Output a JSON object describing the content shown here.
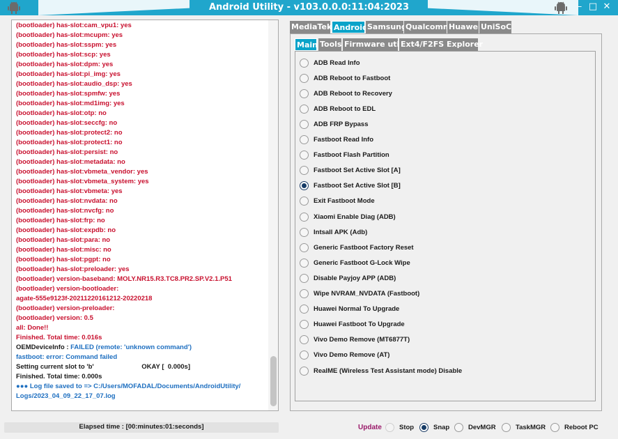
{
  "window": {
    "title": "Android Utility - v103.0.0.0:11:04:2023",
    "minimize": "–",
    "maximize": "□",
    "close": "✕"
  },
  "colors": {
    "titlebar": "#20a6cc",
    "active_tab": "#0aa3c9",
    "log_red": "#c8102e",
    "log_blue": "#1e6fc0"
  },
  "log": [
    {
      "text": "(bootloader) has-slot:cam_vpu1: yes",
      "color": "red"
    },
    {
      "text": "(bootloader) has-slot:mcupm: yes",
      "color": "red"
    },
    {
      "text": "(bootloader) has-slot:sspm: yes",
      "color": "red"
    },
    {
      "text": "(bootloader) has-slot:scp: yes",
      "color": "red"
    },
    {
      "text": "(bootloader) has-slot:dpm: yes",
      "color": "red"
    },
    {
      "text": "(bootloader) has-slot:pi_img: yes",
      "color": "red"
    },
    {
      "text": "(bootloader) has-slot:audio_dsp: yes",
      "color": "red"
    },
    {
      "text": "(bootloader) has-slot:spmfw: yes",
      "color": "red"
    },
    {
      "text": "(bootloader) has-slot:md1img: yes",
      "color": "red"
    },
    {
      "text": "(bootloader) has-slot:otp: no",
      "color": "red"
    },
    {
      "text": "(bootloader) has-slot:seccfg: no",
      "color": "red"
    },
    {
      "text": "(bootloader) has-slot:protect2: no",
      "color": "red"
    },
    {
      "text": "(bootloader) has-slot:protect1: no",
      "color": "red"
    },
    {
      "text": "(bootloader) has-slot:persist: no",
      "color": "red"
    },
    {
      "text": "(bootloader) has-slot:metadata: no",
      "color": "red"
    },
    {
      "text": "(bootloader) has-slot:vbmeta_vendor: yes",
      "color": "red"
    },
    {
      "text": "(bootloader) has-slot:vbmeta_system: yes",
      "color": "red"
    },
    {
      "text": "(bootloader) has-slot:vbmeta: yes",
      "color": "red"
    },
    {
      "text": "(bootloader) has-slot:nvdata: no",
      "color": "red"
    },
    {
      "text": "(bootloader) has-slot:nvcfg: no",
      "color": "red"
    },
    {
      "text": "(bootloader) has-slot:frp: no",
      "color": "red"
    },
    {
      "text": "(bootloader) has-slot:expdb: no",
      "color": "red"
    },
    {
      "text": "(bootloader) has-slot:para: no",
      "color": "red"
    },
    {
      "text": "(bootloader) has-slot:misc: no",
      "color": "red"
    },
    {
      "text": "(bootloader) has-slot:pgpt: no",
      "color": "red"
    },
    {
      "text": "(bootloader) has-slot:preloader: yes",
      "color": "red"
    },
    {
      "text": "(bootloader) version-baseband: MOLY.NR15.R3.TC8.PR2.SP.V2.1.P51",
      "color": "red"
    },
    {
      "text": "(bootloader) version-bootloader:",
      "color": "red"
    },
    {
      "text": "agate-555e9123f-20211220161212-20220218",
      "color": "red"
    },
    {
      "text": "(bootloader) version-preloader:",
      "color": "red"
    },
    {
      "text": "(bootloader) version: 0.5",
      "color": "red"
    },
    {
      "text": "all: Done!!",
      "color": "red"
    },
    {
      "text": "Finished. Total time: 0.016s",
      "color": "red"
    },
    {
      "text": "OEMDeviceInfo  :   FAILED (remote: 'unknown command')",
      "color": "mixed",
      "prefix": "OEMDeviceInfo  :   ",
      "suffix": "FAILED (remote: 'unknown command')"
    },
    {
      "text": "fastboot: error: Command failed",
      "color": "blue"
    },
    {
      "text": "Setting current slot to 'b'                          OKAY [  0.000s]",
      "color": "black"
    },
    {
      "text": "Finished. Total time: 0.000s",
      "color": "black"
    },
    {
      "text": "●●● Log file saved to => C:/Users/MOFADAL/Documents/AndroidUtility/",
      "color": "blue"
    },
    {
      "text": "Logs/2023_04_09_22_17_07.log",
      "color": "blue"
    }
  ],
  "top_tabs": [
    {
      "label": "MediaTek",
      "active": false
    },
    {
      "label": "Android",
      "active": true
    },
    {
      "label": "Samsung",
      "active": false
    },
    {
      "label": "Qualcomm",
      "active": false
    },
    {
      "label": "Huawei",
      "active": false
    },
    {
      "label": "UniSoC",
      "active": false
    }
  ],
  "sub_tabs": [
    {
      "label": "Main",
      "active": true
    },
    {
      "label": "Tools",
      "active": false
    },
    {
      "label": "Firmware utils",
      "active": false
    },
    {
      "label": "Ext4/F2FS Explorer",
      "active": false
    }
  ],
  "options": [
    {
      "label": "ADB Read Info",
      "selected": false
    },
    {
      "label": "ADB Reboot to Fastboot",
      "selected": false
    },
    {
      "label": "ADB Reboot to Recovery",
      "selected": false
    },
    {
      "label": "ADB Reboot to EDL",
      "selected": false
    },
    {
      "label": "ADB FRP Bypass",
      "selected": false
    },
    {
      "label": "Fastboot Read Info",
      "selected": false
    },
    {
      "label": "Fastboot Flash Partition",
      "selected": false
    },
    {
      "label": "Fastboot Set Active Slot [A]",
      "selected": false
    },
    {
      "label": "Fastboot Set Active Slot [B]",
      "selected": true
    },
    {
      "label": "Exit Fastboot Mode",
      "selected": false
    },
    {
      "label": "Xiaomi Enable Diag (ADB)",
      "selected": false
    },
    {
      "label": "Intsall APK (Adb)",
      "selected": false
    },
    {
      "label": "Generic Fastboot Factory Reset",
      "selected": false
    },
    {
      "label": "Generic Fastboot G-Lock Wipe",
      "selected": false
    },
    {
      "label": "Disable Payjoy APP (ADB)",
      "selected": false
    },
    {
      "label": "Wipe NVRAM_NVDATA (Fastboot)",
      "selected": false
    },
    {
      "label": "Huawei Normal To Upgrade",
      "selected": false
    },
    {
      "label": "Huawei Fastboot To Upgrade",
      "selected": false
    },
    {
      "label": "Vivo Demo Remove (MT6877T)",
      "selected": false
    },
    {
      "label": "Vivo Demo Remove (AT)",
      "selected": false
    },
    {
      "label": "RealME (Wireless Test Assistant mode) Disable",
      "selected": false
    }
  ],
  "status": {
    "elapsed": "Elapsed time : [00:minutes:01:seconds]",
    "update": "Update",
    "bottom_options": [
      {
        "label": "Stop",
        "selected": false,
        "disabled": true
      },
      {
        "label": "Snap",
        "selected": true
      },
      {
        "label": "DevMGR",
        "selected": false
      },
      {
        "label": "TaskMGR",
        "selected": false
      },
      {
        "label": "Reboot PC",
        "selected": false
      }
    ]
  }
}
